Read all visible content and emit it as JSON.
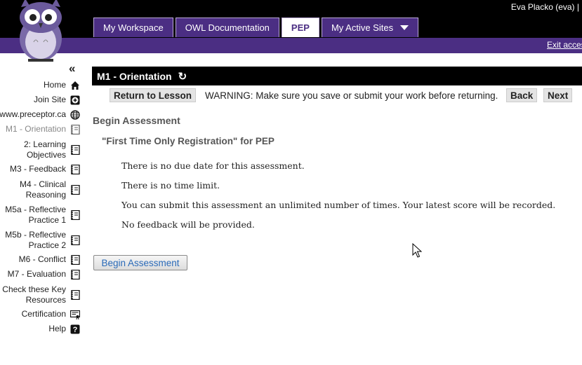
{
  "header": {
    "user": "Eva Placko (eva) |",
    "tabs": [
      {
        "label": "My Workspace"
      },
      {
        "label": "OWL Documentation"
      },
      {
        "label": "PEP"
      },
      {
        "label": "My Active Sites"
      }
    ],
    "exit_label": "Exit acces"
  },
  "sidebar": {
    "collapse_icon": "double-chevron-left-icon",
    "items": [
      {
        "label": "Home",
        "icon": "home-icon"
      },
      {
        "label": "Join Site",
        "icon": "plus-box-icon"
      },
      {
        "label": "www.preceptor.ca",
        "icon": "globe-icon"
      },
      {
        "label": "M1 - Orientation",
        "icon": "notebook-icon"
      },
      {
        "line1": "2: Learning",
        "line2": "Objectives",
        "icon": "notebook-icon"
      },
      {
        "label": "M3 - Feedback",
        "icon": "notebook-icon"
      },
      {
        "line1": "M4 - Clinical",
        "line2": "Reasoning",
        "icon": "notebook-icon"
      },
      {
        "line1": "M5a - Reflective",
        "line2": "Practice 1",
        "icon": "notebook-icon"
      },
      {
        "line1": "M5b - Reflective",
        "line2": "Practice 2",
        "icon": "notebook-icon"
      },
      {
        "label": "M6 - Conflict",
        "icon": "notebook-icon"
      },
      {
        "label": "M7 - Evaluation",
        "icon": "notebook-icon"
      },
      {
        "line1": "Check these Key",
        "line2": "Resources",
        "icon": "notebook-icon"
      },
      {
        "label": "Certification",
        "icon": "certificate-icon"
      },
      {
        "label": "Help",
        "icon": "help-icon"
      }
    ]
  },
  "main": {
    "title": "M1 - Orientation",
    "return_label": "Return to Lesson",
    "warning": "WARNING: Make sure you save or submit your work before returning.",
    "back_label": "Back",
    "next_label": "Next",
    "heading": "Begin Assessment",
    "subheading": "\"First Time Only Registration\" for PEP",
    "info": [
      "There is no due date for this assessment.",
      "There is no time limit.",
      "You can submit this assessment an unlimited number of times. Your latest score will be recorded.",
      "No feedback will be provided."
    ],
    "begin_button": "Begin Assessment"
  },
  "colors": {
    "brand": "#4b2e83",
    "header": "#000000",
    "link": "#2a6ab8"
  }
}
